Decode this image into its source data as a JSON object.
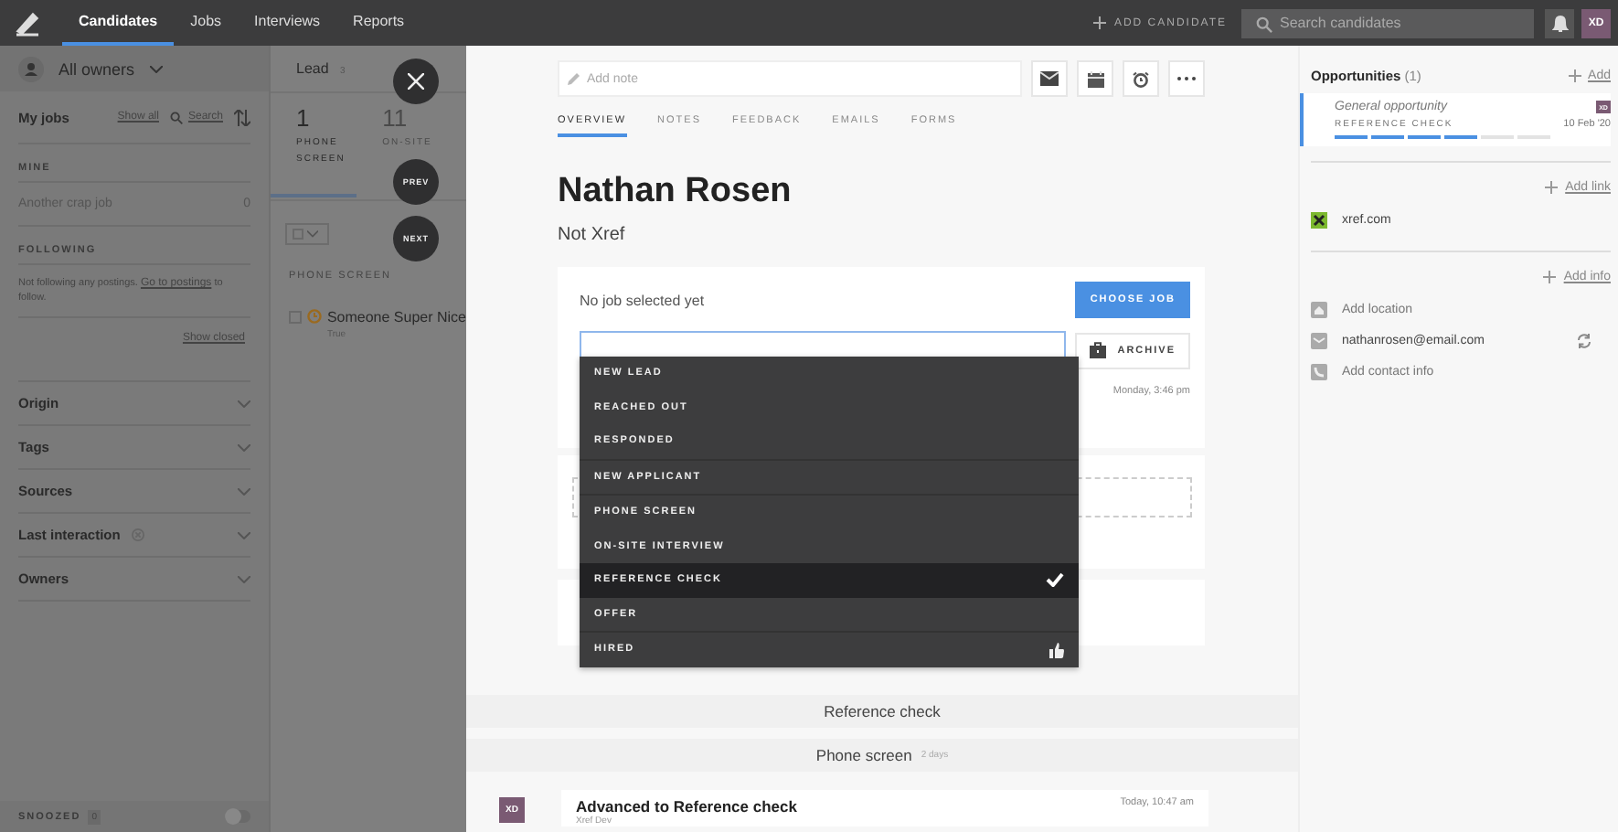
{
  "topbar": {
    "nav": [
      {
        "label": "Candidates",
        "selected": true
      },
      {
        "label": "Jobs",
        "selected": false
      },
      {
        "label": "Interviews",
        "selected": false
      },
      {
        "label": "Reports",
        "selected": false
      }
    ],
    "add_candidate": "ADD CANDIDATE",
    "search": {
      "placeholder": "Search candidates"
    },
    "avatar": "XD"
  },
  "sidebar": {
    "owner_filter": "All owners",
    "my_jobs": {
      "title": "My jobs",
      "show_all": "Show all",
      "search": "Search"
    },
    "mine": {
      "heading": "MINE",
      "jobs": [
        {
          "name": "Another crap job",
          "count": "0"
        }
      ]
    },
    "following": {
      "heading": "FOLLOWING",
      "text_before": "Not following any postings.",
      "link": "Go to postings",
      "text_after": "to follow."
    },
    "show_closed": "Show closed",
    "filters": [
      {
        "label": "Origin",
        "clearable": false
      },
      {
        "label": "Tags",
        "clearable": false
      },
      {
        "label": "Sources",
        "clearable": false
      },
      {
        "label": "Last interaction",
        "clearable": true
      },
      {
        "label": "Owners",
        "clearable": false
      }
    ],
    "snoozed": {
      "label": "SNOOZED",
      "count": "0",
      "on": false
    }
  },
  "pipeline": {
    "tabs": [
      {
        "label": "Lead",
        "count": "3"
      }
    ],
    "stages": [
      {
        "count": "1",
        "label": "PHONE SCREEN",
        "selected": true
      },
      {
        "count": "11",
        "label": "ON-SITE",
        "selected": false
      }
    ],
    "group_heading": "PHONE SCREEN",
    "candidates": [
      {
        "name": "Someone Super Nice",
        "subtitle": "True",
        "checked": false
      }
    ]
  },
  "overlay_controls": {
    "prev": "PREV",
    "next": "NEXT"
  },
  "profile": {
    "note": {
      "placeholder": "Add note"
    },
    "tabs": [
      {
        "label": "OVERVIEW",
        "selected": true
      },
      {
        "label": "NOTES",
        "selected": false
      },
      {
        "label": "FEEDBACK",
        "selected": false
      },
      {
        "label": "EMAILS",
        "selected": false
      },
      {
        "label": "FORMS",
        "selected": false
      }
    ],
    "name": "Nathan Rosen",
    "headline": "Not Xref",
    "job_card": {
      "text": "No job selected yet",
      "choose_job": "CHOOSE JOB",
      "archive": "ARCHIVE",
      "timestamp": "Monday, 3:46 pm"
    },
    "stage_menu": [
      {
        "items": [
          {
            "label": "NEW LEAD",
            "selected": false,
            "kind": "stage"
          },
          {
            "label": "REACHED OUT",
            "selected": false,
            "kind": "stage"
          },
          {
            "label": "RESPONDED",
            "selected": false,
            "kind": "stage"
          }
        ]
      },
      {
        "items": [
          {
            "label": "NEW APPLICANT",
            "selected": false,
            "kind": "stage"
          }
        ]
      },
      {
        "items": [
          {
            "label": "PHONE SCREEN",
            "selected": false,
            "kind": "stage"
          },
          {
            "label": "ON-SITE INTERVIEW",
            "selected": false,
            "kind": "stage"
          },
          {
            "label": "REFERENCE CHECK",
            "selected": true,
            "kind": "stage"
          },
          {
            "label": "OFFER",
            "selected": false,
            "kind": "stage"
          }
        ]
      },
      {
        "items": [
          {
            "label": "HIRED",
            "selected": false,
            "kind": "hired"
          }
        ]
      }
    ],
    "timeline": {
      "sections": [
        {
          "title": "Reference check"
        },
        {
          "title": "Phone screen",
          "meta": "2 days"
        }
      ],
      "events": [
        {
          "avatar": "XD",
          "title": "Advanced to Reference check",
          "author": "Xref Dev",
          "time": "Today, 10:47 am"
        }
      ]
    }
  },
  "details": {
    "opportunities": {
      "title": "Opportunities",
      "count": "(1)",
      "add": "Add",
      "items": [
        {
          "title": "General opportunity",
          "avatar": "XD",
          "stage": "REFERENCE CHECK",
          "date": "10 Feb '20",
          "steps": [
            {
              "done": true
            },
            {
              "done": true
            },
            {
              "done": true
            },
            {
              "done": true
            },
            {
              "done": false
            },
            {
              "done": false
            }
          ]
        }
      ]
    },
    "add_link": "Add link",
    "links": [
      {
        "label": "xref.com"
      }
    ],
    "add_info": "Add info",
    "info": [
      {
        "kind": "location",
        "label": "Add location",
        "placeholder": true
      },
      {
        "kind": "email",
        "label": "nathanrosen@email.com",
        "placeholder": false
      },
      {
        "kind": "phone",
        "label": "Add contact info",
        "placeholder": true
      }
    ]
  }
}
